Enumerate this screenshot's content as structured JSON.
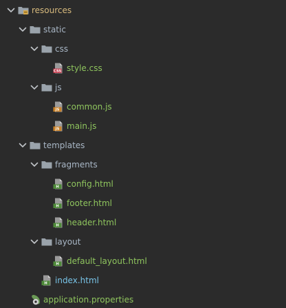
{
  "colors": {
    "background": "#2b2b2b",
    "folder_text": "#a9b7c6",
    "resource_root_text": "#d7ba7d",
    "resource_file_text": "#8fc55e",
    "html_template_text": "#79c4e8",
    "chevron": "#c0c4c8",
    "folder_icon": "#9aa3ab",
    "css_icon": "#c43a4c",
    "js_icon": "#c9822a",
    "html_icon": "#4f8a3a",
    "properties_icon": "#6a9955"
  },
  "tree": {
    "items": [
      {
        "label": "resources",
        "kind": "resource-root",
        "expanded": true,
        "depth": 0,
        "icon": "resource-folder-icon"
      },
      {
        "label": "static",
        "kind": "folder",
        "expanded": true,
        "depth": 1,
        "icon": "folder-icon"
      },
      {
        "label": "css",
        "kind": "folder",
        "expanded": true,
        "depth": 2,
        "icon": "folder-icon"
      },
      {
        "label": "style.css",
        "kind": "file",
        "depth": 3,
        "icon": "css-file-icon",
        "badge": "CSS"
      },
      {
        "label": "js",
        "kind": "folder",
        "expanded": true,
        "depth": 2,
        "icon": "folder-icon"
      },
      {
        "label": "common.js",
        "kind": "file",
        "depth": 3,
        "icon": "js-file-icon",
        "badge": "JS"
      },
      {
        "label": "main.js",
        "kind": "file",
        "depth": 3,
        "icon": "js-file-icon",
        "badge": "JS"
      },
      {
        "label": "templates",
        "kind": "folder",
        "expanded": true,
        "depth": 1,
        "icon": "folder-icon"
      },
      {
        "label": "fragments",
        "kind": "folder",
        "expanded": true,
        "depth": 2,
        "icon": "folder-icon"
      },
      {
        "label": "config.html",
        "kind": "file",
        "depth": 3,
        "icon": "html-file-icon",
        "badge": "H"
      },
      {
        "label": "footer.html",
        "kind": "file",
        "depth": 3,
        "icon": "html-file-icon",
        "badge": "H"
      },
      {
        "label": "header.html",
        "kind": "file",
        "depth": 3,
        "icon": "html-file-icon",
        "badge": "H"
      },
      {
        "label": "layout",
        "kind": "folder",
        "expanded": true,
        "depth": 2,
        "icon": "folder-icon"
      },
      {
        "label": "default_layout.html",
        "kind": "file",
        "depth": 3,
        "icon": "html-file-icon",
        "badge": "H"
      },
      {
        "label": "index.html",
        "kind": "file",
        "depth": 2,
        "icon": "html-file-icon",
        "badge": "H"
      },
      {
        "label": "application.properties",
        "kind": "file",
        "depth": 1,
        "icon": "properties-file-icon"
      }
    ]
  }
}
